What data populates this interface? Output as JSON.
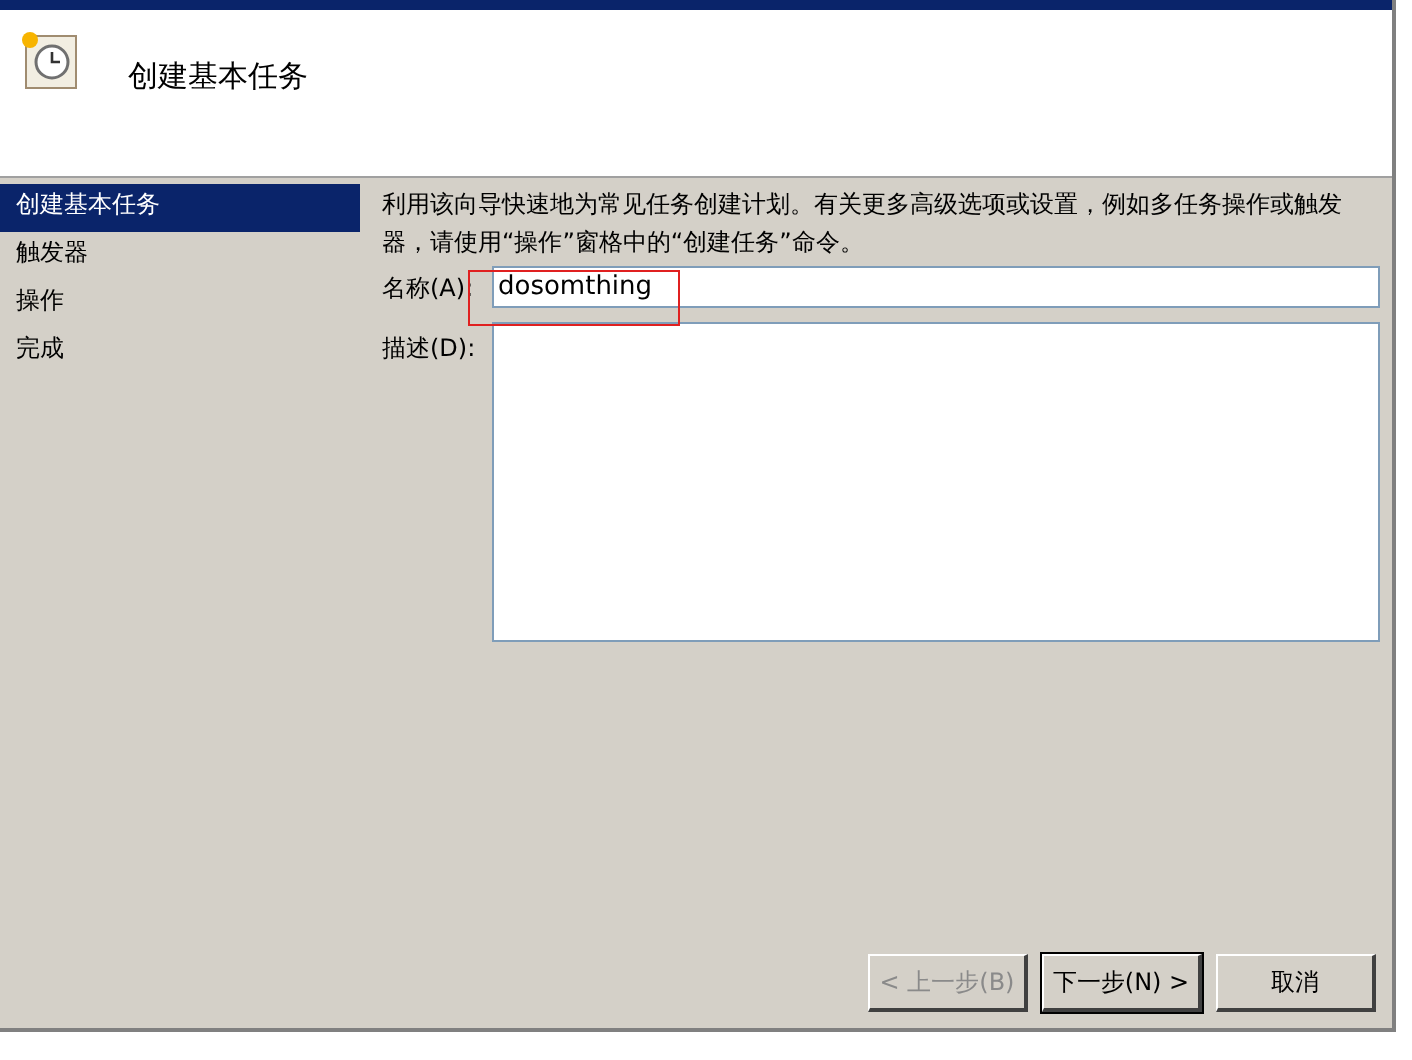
{
  "header": {
    "title": "创建基本任务"
  },
  "steps": [
    {
      "label": "创建基本任务",
      "selected": true
    },
    {
      "label": "触发器",
      "selected": false
    },
    {
      "label": "操作",
      "selected": false
    },
    {
      "label": "完成",
      "selected": false
    }
  ],
  "intro": "利用该向导快速地为常见任务创建计划。有关更多高级选项或设置，例如多任务操作或触发器，请使用“操作”窗格中的“创建任务”命令。",
  "name_field": {
    "label": "名称(A):",
    "value": "dosomthing"
  },
  "description_field": {
    "label": "描述(D):"
  },
  "buttons": [
    {
      "label": "< 上一步(B)",
      "disabled": true,
      "default": false
    },
    {
      "label": "下一步(N) >",
      "disabled": false,
      "default": true
    },
    {
      "label": "取消",
      "disabled": false,
      "default": false
    }
  ]
}
